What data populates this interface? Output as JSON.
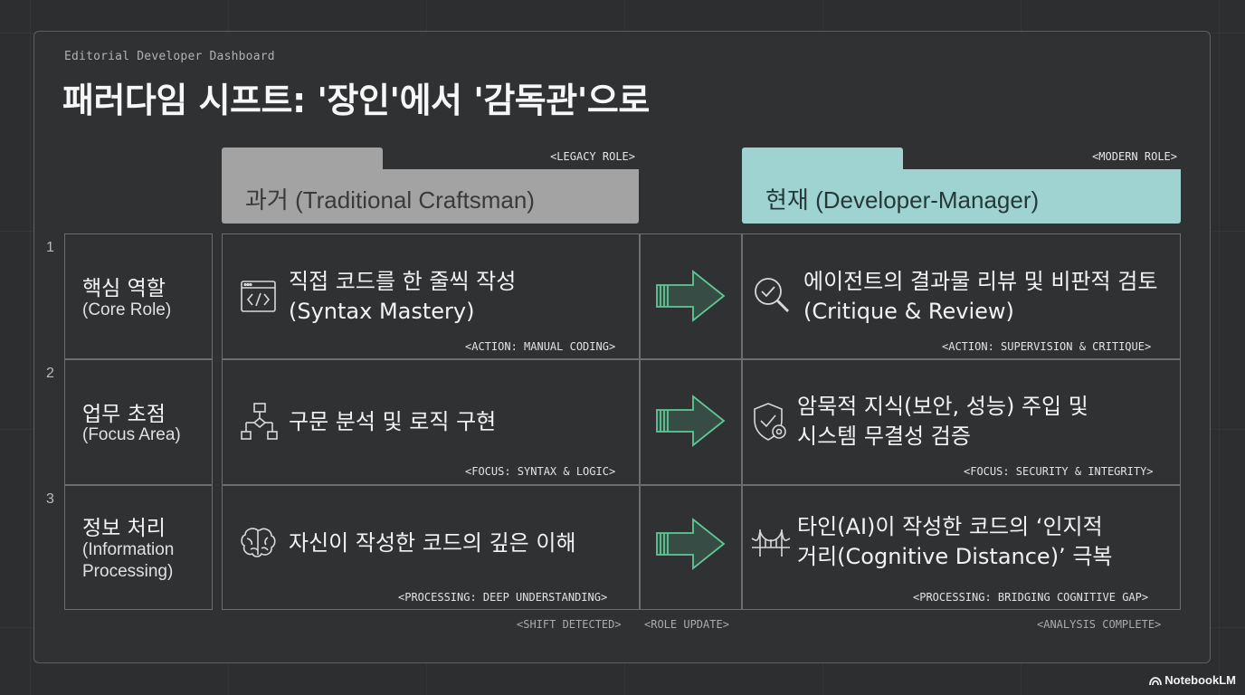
{
  "header": {
    "subtitle": "Editorial Developer Dashboard",
    "title": "패러다임 시프트: '장인'에서 '감독관'으로"
  },
  "columns": {
    "legacy": {
      "tag": "<LEGACY ROLE>",
      "label": "과거 (Traditional Craftsman)",
      "color": "#a3a3a3"
    },
    "modern": {
      "tag": "<MODERN ROLE>",
      "label": "현재 (Developer-Manager)",
      "color": "#9ed3d1"
    }
  },
  "rows": [
    {
      "num": "1",
      "category_ko": "핵심 역할",
      "category_en": "(Core Role)",
      "legacy_icon": "code-window-icon",
      "legacy_text": [
        "직접 코드를 한 줄씩 작성",
        "(Syntax Mastery)"
      ],
      "legacy_code": "<ACTION: MANUAL CODING>",
      "modern_icon": "magnifier-check-icon",
      "modern_text": [
        "에이전트의 결과물 리뷰 및 비판적 검토",
        "(Critique & Review)"
      ],
      "modern_code": "<ACTION: SUPERVISION & CRITIQUE>"
    },
    {
      "num": "2",
      "category_ko": "업무 초점",
      "category_en": "(Focus Area)",
      "legacy_icon": "flowchart-icon",
      "legacy_text": [
        "구문 분석 및 로직 구현"
      ],
      "legacy_code": "<FOCUS: SYNTAX & LOGIC>",
      "modern_icon": "shield-gear-icon",
      "modern_text": [
        "암묵적 지식(보안, 성능) 주입 및",
        "시스템 무결성 검증"
      ],
      "modern_code": "<FOCUS: SECURITY & INTEGRITY>"
    },
    {
      "num": "3",
      "category_ko": "정보 처리",
      "category_en": "(Information Processing)",
      "legacy_icon": "brain-icon",
      "legacy_text": [
        "자신이 작성한 코드의 깊은 이해"
      ],
      "legacy_code": "<PROCESSING: DEEP UNDERSTANDING>",
      "modern_icon": "bridge-icon",
      "modern_text": [
        "타인(AI)이 작성한 코드의 ‘인지적",
        "거리(Cognitive Distance)’ 극복"
      ],
      "modern_code": "<PROCESSING: BRIDGING COGNITIVE GAP>"
    }
  ],
  "footer": {
    "shift": "<SHIFT DETECTED>",
    "role_update": "<ROLE UPDATE>",
    "analysis": "<ANALYSIS COMPLETE>"
  },
  "brand": "NotebookLM",
  "arrow_color": "#5fc896"
}
